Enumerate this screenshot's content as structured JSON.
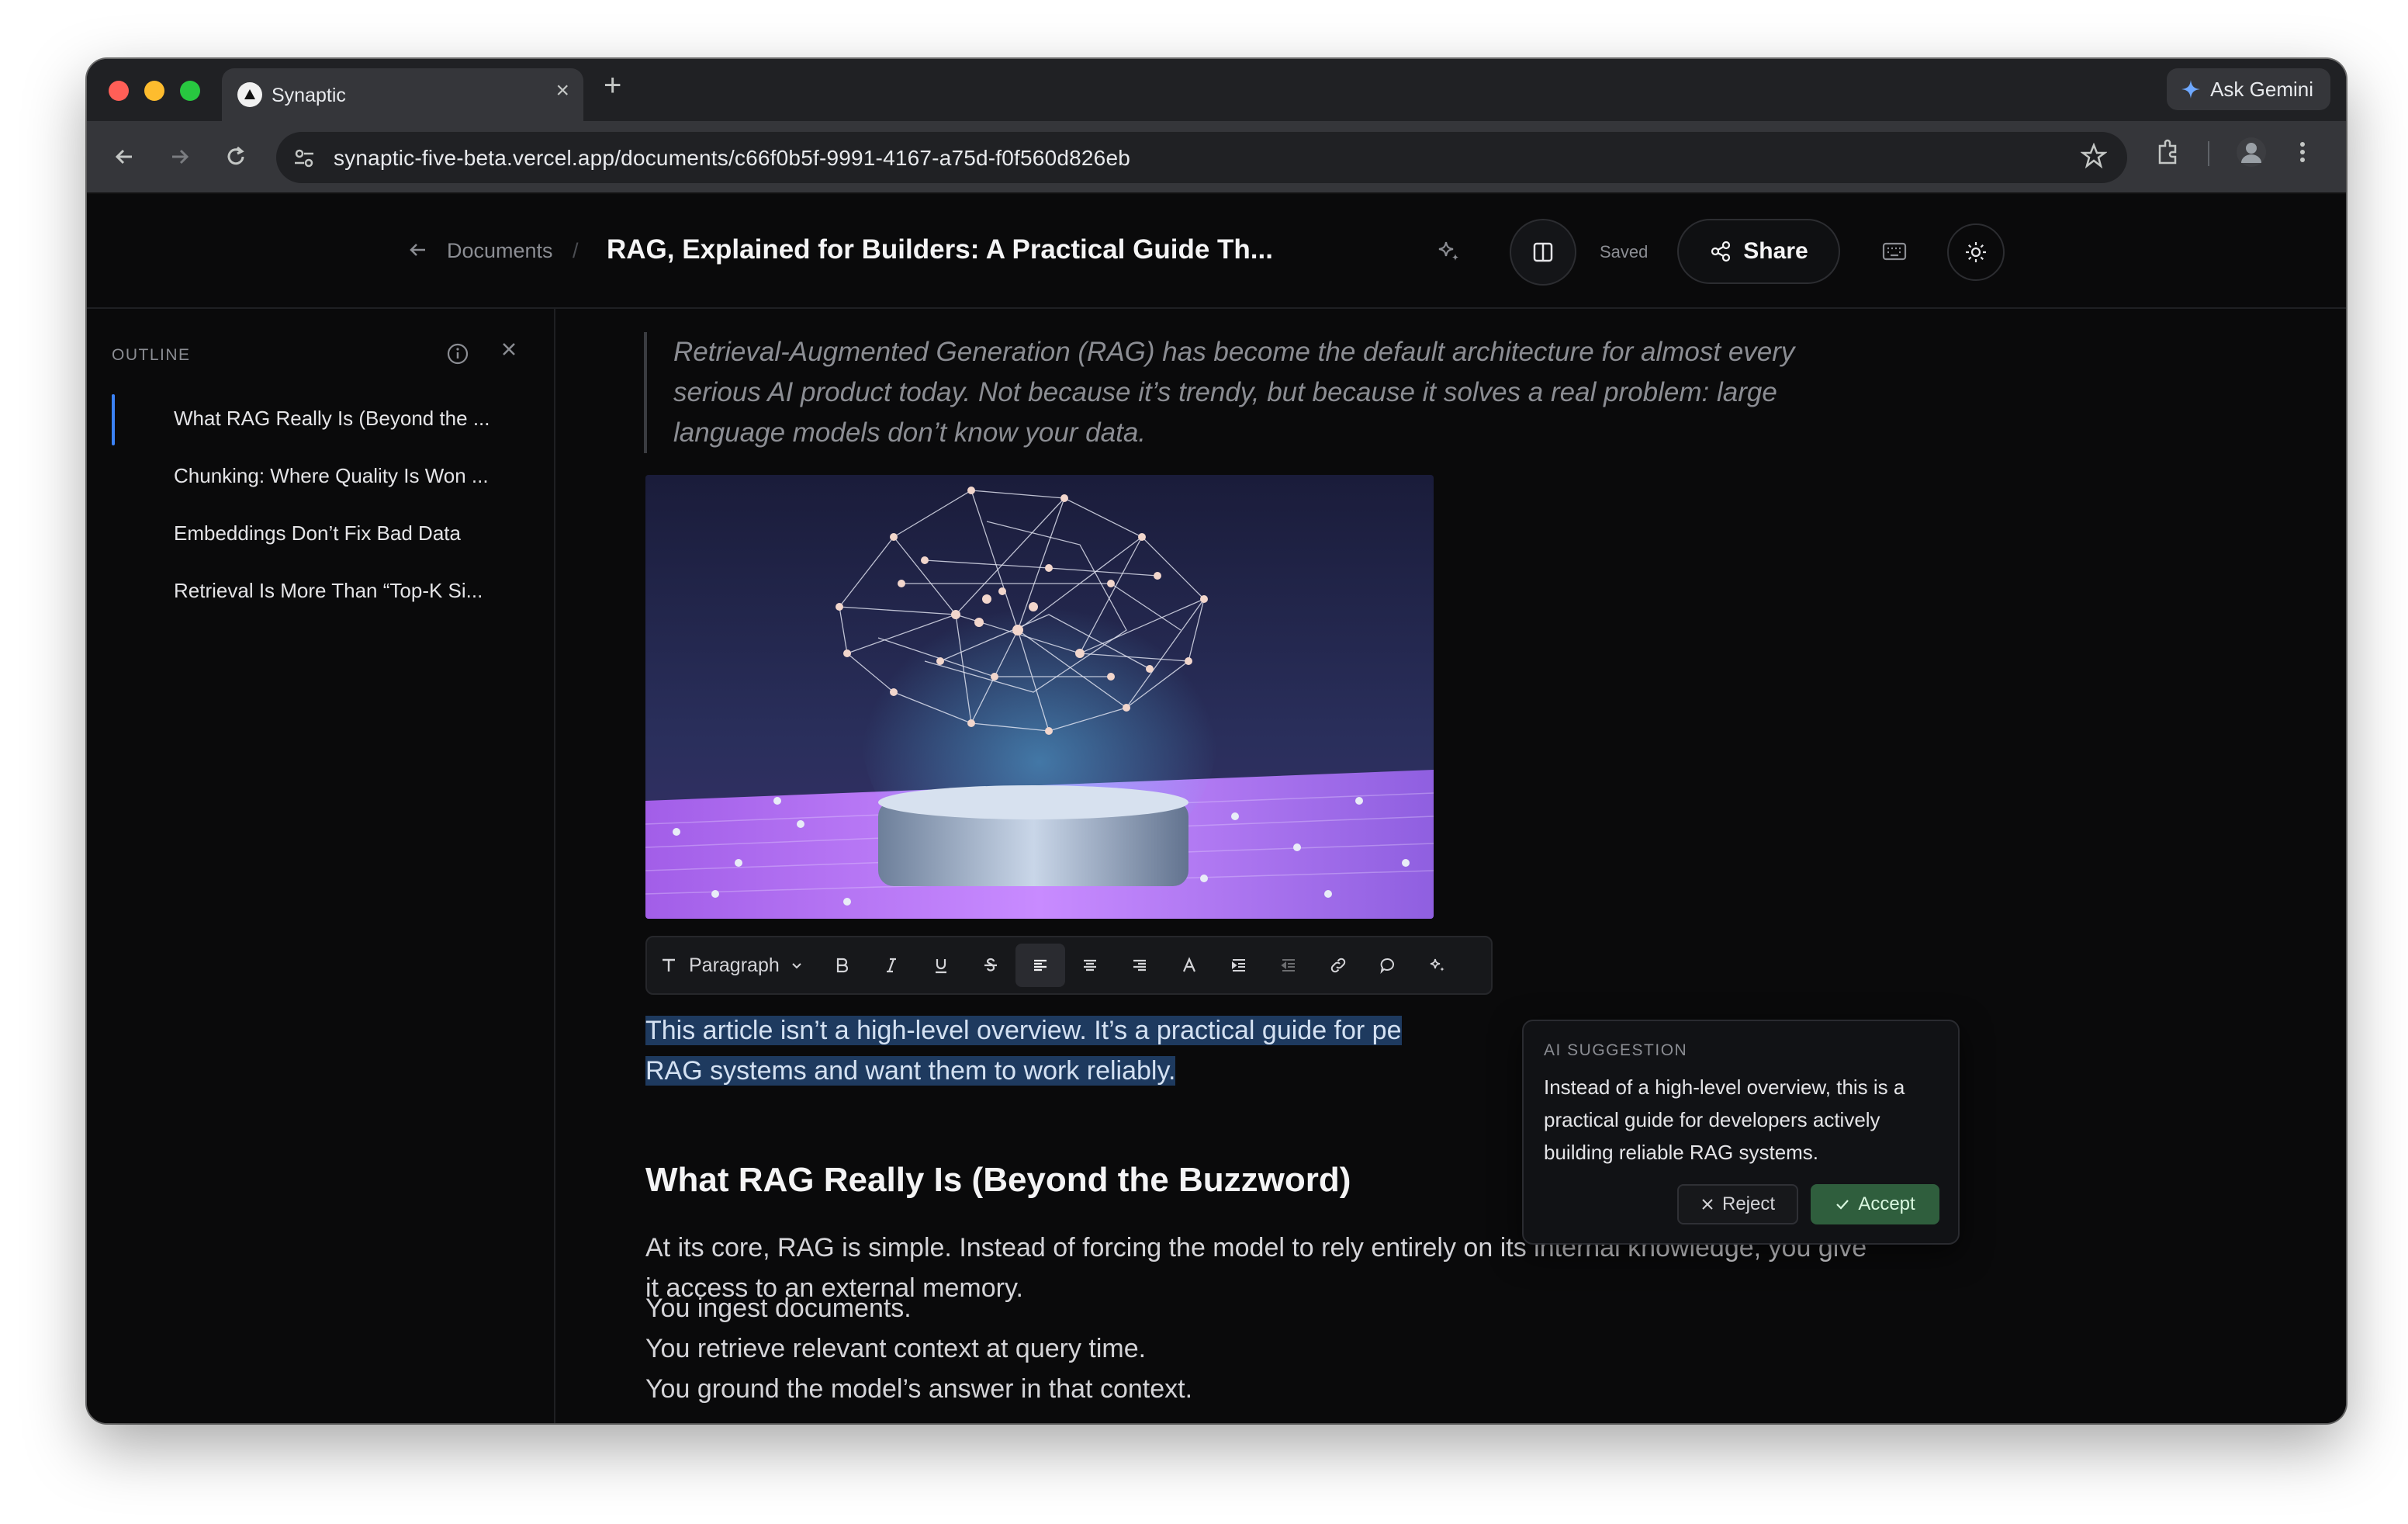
{
  "browser": {
    "tab_title": "Synaptic",
    "url": "synaptic-five-beta.vercel.app/documents/c66f0b5f-9991-4167-a75d-f0f560d826eb",
    "ask_gemini": "Ask Gemini",
    "new_tab": "+",
    "tab_close": "×"
  },
  "header": {
    "breadcrumb_documents": "Documents",
    "breadcrumb_separator": "/",
    "title": "RAG, Explained for Builders: A Practical Guide Th...",
    "saved": "Saved",
    "share": "Share"
  },
  "outline": {
    "label": "OUTLINE",
    "items": [
      {
        "label": "What RAG Really Is (Beyond the ..."
      },
      {
        "label": "Chunking: Where Quality Is Won ..."
      },
      {
        "label": "Embeddings Don’t Fix Bad Data"
      },
      {
        "label": "Retrieval Is More Than “Top-K Si..."
      }
    ]
  },
  "editor": {
    "quote": "Retrieval-Augmented Generation (RAG) has become the default architecture for almost every serious AI product today. Not because it’s trendy, but because it solves a real problem: large language models don’t know your data.",
    "toolbar": {
      "block_type": "Paragraph"
    },
    "selected_line1": "This article isn’t a high-level overview. It’s a practical guide for pe",
    "selected_line2": "RAG systems and want them to work reliably.",
    "heading": "What RAG Really Is (Beyond the Buzzword)",
    "para1": "At its core, RAG is simple. Instead of forcing the model to rely entirely on its internal knowledge, you give it access to an external memory.",
    "line1": "You ingest documents.",
    "line2": "You retrieve relevant context at query time.",
    "line3": "You ground the model’s answer in that context."
  },
  "ai_suggestion": {
    "label": "AI SUGGESTION",
    "text": "Instead of a high-level overview, this is a practical guide for developers actively building reliable RAG systems.",
    "reject": "Reject",
    "accept": "Accept"
  },
  "colors": {
    "accent_blue": "#3b82f6",
    "accept_green": "#2f5e3d",
    "selection": "#1e3a5f"
  }
}
